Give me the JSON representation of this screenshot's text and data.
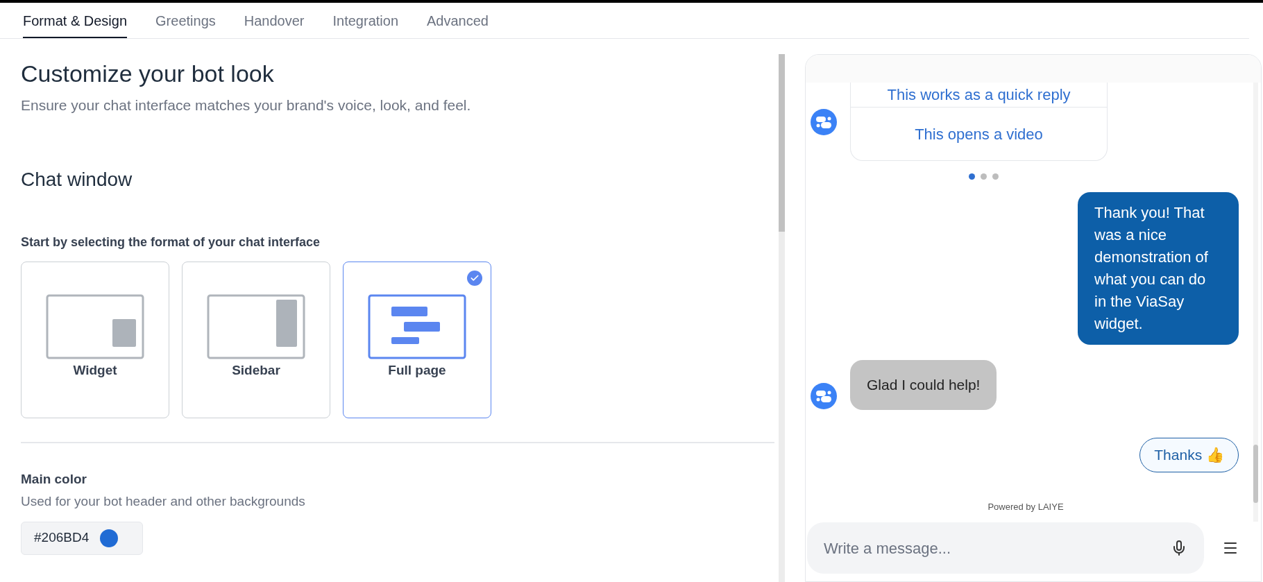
{
  "tabs": [
    {
      "label": "Format & Design",
      "selected": true
    },
    {
      "label": "Greetings",
      "selected": false
    },
    {
      "label": "Handover",
      "selected": false
    },
    {
      "label": "Integration",
      "selected": false
    },
    {
      "label": "Advanced",
      "selected": false
    }
  ],
  "page": {
    "title": "Customize your bot look",
    "subtitle": "Ensure your chat interface matches your brand's voice, look, and feel."
  },
  "chat_window": {
    "heading": "Chat window",
    "format_prompt": "Start by selecting the format of your chat interface",
    "formats": [
      {
        "kind": "widget",
        "label": "Widget",
        "selected": false
      },
      {
        "kind": "sidebar",
        "label": "Sidebar",
        "selected": false
      },
      {
        "kind": "fullpage",
        "label": "Full page",
        "selected": true
      }
    ]
  },
  "main_color": {
    "label": "Main color",
    "description": "Used for your bot header and other backgrounds",
    "value": "#206BD4",
    "color": "#206bd4"
  },
  "preview": {
    "quick_replies": [
      "This works as a quick reply",
      "This opens a video"
    ],
    "carousel_dots": [
      {
        "selected": true
      },
      {
        "selected": false
      },
      {
        "selected": false
      }
    ],
    "messages": [
      {
        "kind": "user",
        "text": "Thank you! That was a nice demonstration of what you can do in the ViaSay widget."
      },
      {
        "kind": "bot",
        "text": "Glad I could help!"
      },
      {
        "kind": "reply",
        "text": "Thanks 👍"
      }
    ],
    "powered_by": "Powered by LAIYE",
    "input": {
      "placeholder": "Write a message..."
    }
  }
}
